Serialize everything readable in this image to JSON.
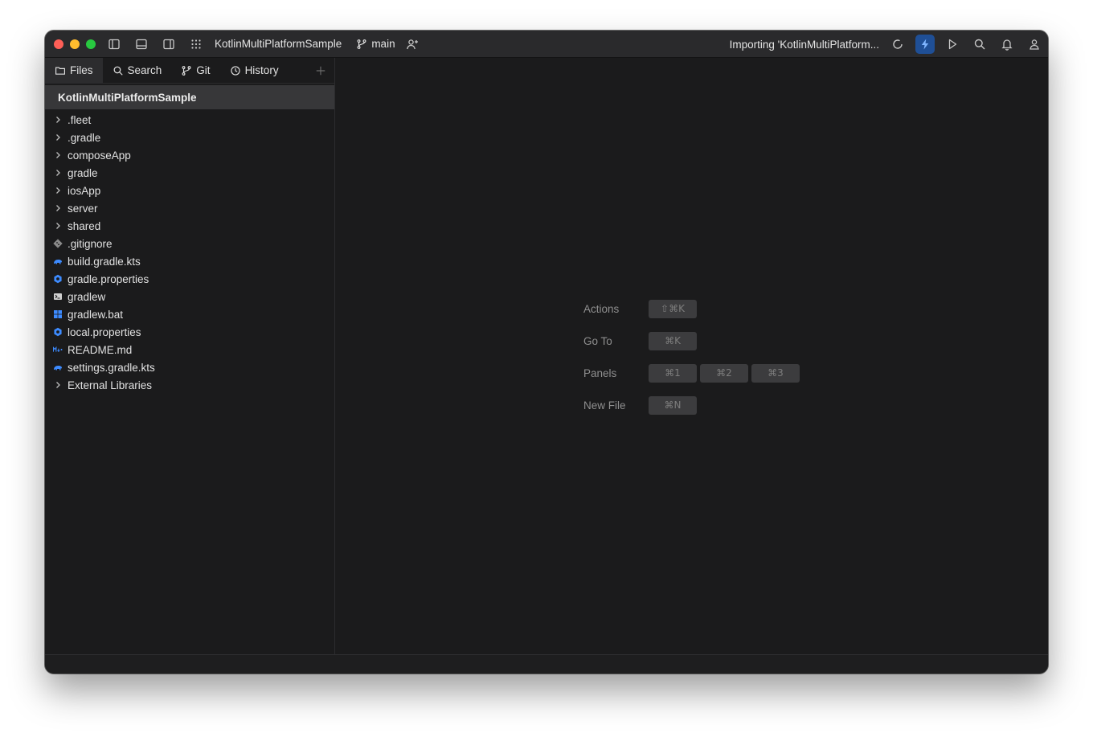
{
  "titlebar": {
    "project_name": "KotlinMultiPlatformSample",
    "branch": "main",
    "importing_status": "Importing 'KotlinMultiPlatform..."
  },
  "sidebar": {
    "tabs": [
      {
        "label": "Files",
        "icon": "folder-icon",
        "active": true
      },
      {
        "label": "Search",
        "icon": "search-icon",
        "active": false
      },
      {
        "label": "Git",
        "icon": "git-branch-icon",
        "active": false
      },
      {
        "label": "History",
        "icon": "clock-icon",
        "active": false
      }
    ],
    "root": "KotlinMultiPlatformSample",
    "items": [
      {
        "label": ".fleet",
        "type": "folder"
      },
      {
        "label": ".gradle",
        "type": "folder"
      },
      {
        "label": "composeApp",
        "type": "folder"
      },
      {
        "label": "gradle",
        "type": "folder"
      },
      {
        "label": "iosApp",
        "type": "folder"
      },
      {
        "label": "server",
        "type": "folder"
      },
      {
        "label": "shared",
        "type": "folder"
      },
      {
        "label": ".gitignore",
        "type": "git-file"
      },
      {
        "label": "build.gradle.kts",
        "type": "gradle-file"
      },
      {
        "label": "gradle.properties",
        "type": "properties-file"
      },
      {
        "label": "gradlew",
        "type": "terminal-file"
      },
      {
        "label": "gradlew.bat",
        "type": "windows-file"
      },
      {
        "label": "local.properties",
        "type": "properties-file"
      },
      {
        "label": "README.md",
        "type": "markdown-file"
      },
      {
        "label": "settings.gradle.kts",
        "type": "gradle-file"
      },
      {
        "label": "External Libraries",
        "type": "folder"
      }
    ]
  },
  "shortcuts": [
    {
      "label": "Actions",
      "keys": [
        "⇧⌘K"
      ]
    },
    {
      "label": "Go To",
      "keys": [
        "⌘K"
      ]
    },
    {
      "label": "Panels",
      "keys": [
        "⌘1",
        "⌘2",
        "⌘3"
      ]
    },
    {
      "label": "New File",
      "keys": [
        "⌘N"
      ]
    }
  ],
  "colors": {
    "accent": "#1f4f96",
    "window_bg": "#1b1b1c",
    "file_icon_blue": "#3d8bff"
  }
}
